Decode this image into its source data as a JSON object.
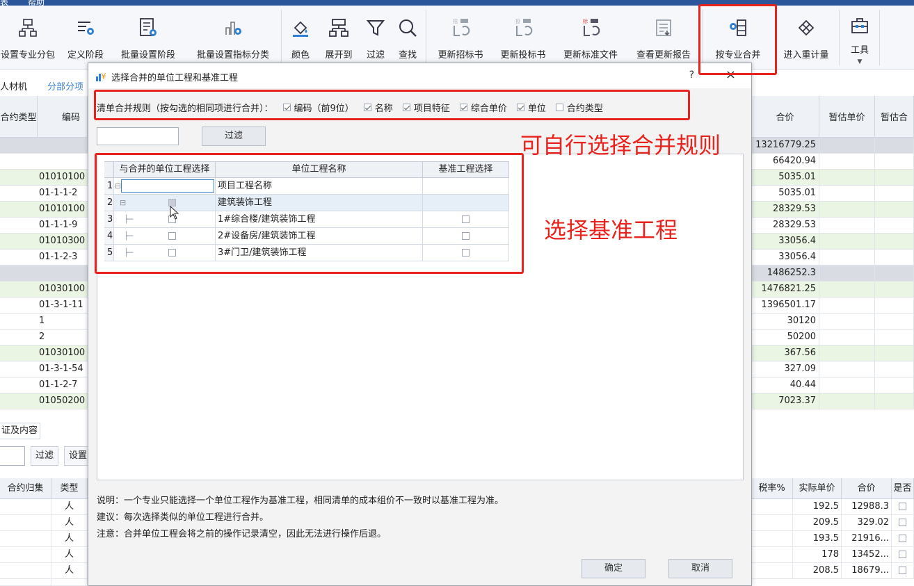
{
  "menubar": {
    "items": [
      "表",
      "帮助"
    ]
  },
  "ribbon": {
    "buttons": [
      {
        "label": "设置专业分包",
        "icon": "org-chart-icon"
      },
      {
        "label": "定义阶段",
        "icon": "stage-settings-icon"
      },
      {
        "label": "批量设置阶段",
        "icon": "batch-stage-icon"
      },
      {
        "label": "批量设置指标分类",
        "icon": "index-category-icon"
      },
      {
        "label": "颜色",
        "icon": "paint-bucket-icon"
      },
      {
        "label": "展开到",
        "icon": "expand-tree-icon"
      },
      {
        "label": "过滤",
        "icon": "filter-icon"
      },
      {
        "label": "查找",
        "icon": "search-icon"
      },
      {
        "label": "更新招标书",
        "icon": "update-tender-icon"
      },
      {
        "label": "更新投标书",
        "icon": "update-bid-icon"
      },
      {
        "label": "更新标准文件",
        "icon": "update-standard-icon"
      },
      {
        "label": "查看更新报告",
        "icon": "report-icon"
      },
      {
        "label": "按专业合并",
        "icon": "merge-icon"
      },
      {
        "label": "进入重计量",
        "icon": "remeasure-icon"
      },
      {
        "label": "工具",
        "icon": "toolbox-icon"
      }
    ]
  },
  "background": {
    "tabs": [
      "人材机",
      "分部分项"
    ],
    "left_headers": [
      "合约类型",
      "编码"
    ],
    "left_rows": [
      "",
      "",
      "01010100",
      "01-1-1-2",
      "01010100",
      "01-1-1-9",
      "01010300",
      "01-1-2-3",
      "",
      "01030100",
      "01-3-1-11",
      "1",
      "2",
      "01030100",
      "01-3-1-54",
      "01-1-2-7",
      "01050200"
    ],
    "right_headers": [
      "合价",
      "暂估单价",
      "暂估合"
    ],
    "right_values": [
      "13216779.25",
      "66420.94",
      "5035.01",
      "5035.01",
      "28329.53",
      "28329.53",
      "33056.4",
      "33056.4",
      "1486252.3",
      "1476821.25",
      "1396501.17",
      "30120",
      "50200",
      "367.56",
      "327.09",
      "40.44",
      "7023.37"
    ],
    "lower_tab": "证及内容",
    "lower_filter_btn": "过滤",
    "lower_set_btn": "设置",
    "lower_headers": [
      "合约归集",
      "类型",
      "税率%",
      "实际单价",
      "合价",
      "是否"
    ],
    "lower_type": "人",
    "lower_rows": [
      {
        "price": "192.5",
        "total": "12988.3"
      },
      {
        "price": "209.5",
        "total": "329.02"
      },
      {
        "price": "193.5",
        "total": "21916..."
      },
      {
        "price": "178",
        "total": "13452..."
      },
      {
        "price": "208.5",
        "total": "18679..."
      }
    ]
  },
  "dialog": {
    "title": "选择合并的单位工程和基准工程",
    "help": "?",
    "close": "×",
    "rule_label": "清单合并规则（按勾选的相同项进行合并）：",
    "rules": [
      {
        "label": "编码（前9位）",
        "checked": true
      },
      {
        "label": "名称",
        "checked": true
      },
      {
        "label": "项目特征",
        "checked": true
      },
      {
        "label": "综合单价",
        "checked": true
      },
      {
        "label": "单位",
        "checked": true
      },
      {
        "label": "合约类型",
        "checked": false
      }
    ],
    "filter_button": "过滤",
    "grid": {
      "headers": [
        "与合并的单位工程选择",
        "单位工程名称",
        "基准工程选择"
      ],
      "rows": [
        {
          "num": "1",
          "tree": "⊟",
          "name": "项目工程名称",
          "has_select": false,
          "has_base": false
        },
        {
          "num": "2",
          "tree": "⊟",
          "name": "建筑装饰工程",
          "has_select": true,
          "has_base": false
        },
        {
          "num": "3",
          "tree": "",
          "name": "1#综合楼/建筑装饰工程",
          "has_select": true,
          "has_base": true
        },
        {
          "num": "4",
          "tree": "",
          "name": "2#设备房/建筑装饰工程",
          "has_select": true,
          "has_base": true
        },
        {
          "num": "5",
          "tree": "",
          "name": "3#门卫/建筑装饰工程",
          "has_select": true,
          "has_base": true
        }
      ]
    },
    "notes": [
      "说明：一个专业只能选择一个单位工程作为基准工程，相同清单的成本组价不一致时以基准工程为准。",
      "建议：每次选择类似的单位工程进行合并。",
      "注意：合并单位工程会将之前的操作记录清空，因此无法进行操作后退。"
    ],
    "ok_button": "确定",
    "cancel_button": "取消"
  },
  "annotations": {
    "rule_text": "可自行选择合并规则",
    "base_text": "选择基准工程",
    "color": "#e8231d"
  }
}
